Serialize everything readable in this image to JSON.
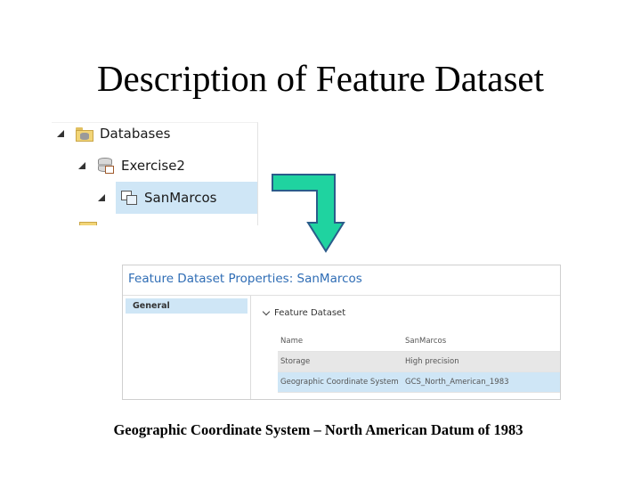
{
  "slide": {
    "title": "Description of Feature Dataset",
    "caption": "Geographic Coordinate System – North American Datum of 1983"
  },
  "tree": {
    "items": [
      {
        "label": "Databases",
        "icon": "database-folder-icon",
        "expanded": true,
        "selected": false
      },
      {
        "label": "Exercise2",
        "icon": "geodatabase-icon",
        "expanded": true,
        "selected": false
      },
      {
        "label": "SanMarcos",
        "icon": "feature-dataset-icon",
        "expanded": true,
        "selected": true
      }
    ],
    "cut_off_item_icon": "folder-icon"
  },
  "arrow": {
    "color": "#1fd3a0",
    "outline": "#2a5c8a",
    "icon": "bent-down-arrow-icon"
  },
  "dialog": {
    "title": "Feature Dataset Properties: SanMarcos",
    "nav": [
      {
        "label": "General",
        "selected": true
      }
    ],
    "section": {
      "label": "Feature Dataset",
      "icon": "chevron-down-icon"
    },
    "properties": [
      {
        "key": "Name",
        "value": "SanMarcos"
      },
      {
        "key": "Storage",
        "value": "High precision"
      },
      {
        "key": "Geographic Coordinate System",
        "value": "GCS_North_American_1983"
      }
    ]
  },
  "colors": {
    "selection": "#cfe6f6",
    "title_blue": "#2f6db5"
  }
}
